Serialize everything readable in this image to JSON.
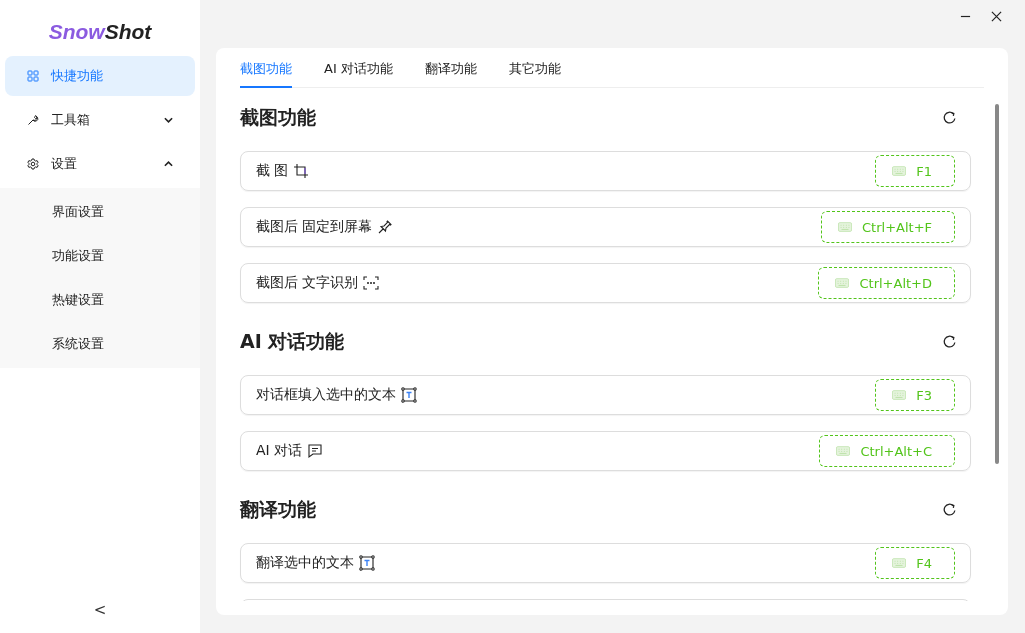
{
  "app": {
    "logo_part_1": "Snow",
    "logo_part_2": "Shot"
  },
  "sidebar": {
    "items": [
      {
        "label": "快捷功能",
        "kind": "grid",
        "selected": true
      },
      {
        "label": "工具箱",
        "kind": "wrench",
        "selected": false,
        "expanded": false
      },
      {
        "label": "设置",
        "kind": "gear",
        "selected": false,
        "expanded": true,
        "children": [
          {
            "label": "界面设置",
            "selected": false
          },
          {
            "label": "功能设置",
            "selected": false
          },
          {
            "label": "热键设置",
            "selected": false
          },
          {
            "label": "系统设置",
            "selected": false
          }
        ]
      }
    ],
    "collapse": "<"
  },
  "tabs": [
    {
      "label": "截图功能",
      "selected": true
    },
    {
      "label": "AI 对话功能",
      "selected": false
    },
    {
      "label": "翻译功能",
      "selected": false
    },
    {
      "label": "其它功能",
      "selected": false
    }
  ],
  "sections": [
    {
      "title": "截图功能",
      "rows": [
        {
          "label": "截 图",
          "kind": "crop",
          "shortcut": "F1"
        },
        {
          "label": "截图后 固定到屏幕",
          "kind": "pin",
          "shortcut": "Ctrl+Alt+F"
        },
        {
          "label": "截图后 文字识别",
          "kind": "ocr",
          "shortcut": "Ctrl+Alt+D"
        }
      ]
    },
    {
      "title": "AI 对话功能",
      "rows": [
        {
          "label": "对话框填入选中的文本",
          "kind": "text-select",
          "shortcut": "F3"
        },
        {
          "label": "AI 对话",
          "kind": "chat",
          "shortcut": "Ctrl+Alt+C"
        }
      ]
    },
    {
      "title": "翻译功能",
      "rows": [
        {
          "label": "翻译选中的文本",
          "kind": "text-select",
          "shortcut": "F4"
        },
        {
          "kind": "empty"
        }
      ]
    }
  ]
}
